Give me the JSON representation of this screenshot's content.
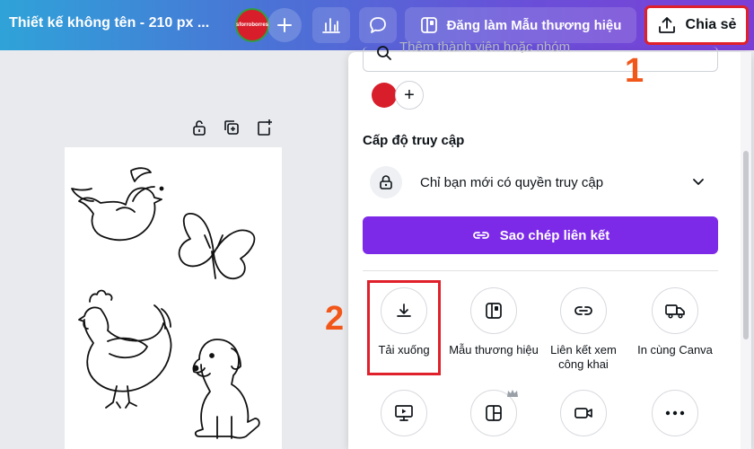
{
  "topbar": {
    "title": "Thiết kế không tên - 210 px ...",
    "avatar_text": "sforroborres",
    "brand_button": "Đăng làm Mẫu thương hiệu",
    "share_button": "Chia sẻ"
  },
  "panel": {
    "search_placeholder": "Thêm thành viên hoặc nhóm",
    "add_plus": "+",
    "access_label": "Cấp độ truy cập",
    "access_value": "Chỉ bạn mới có quyền truy cập",
    "copy_link": "Sao chép liên kết",
    "options_row1": [
      {
        "label": "Tải xuống",
        "icon": "download-icon"
      },
      {
        "label": "Mẫu thương hiệu",
        "icon": "brand-template-icon"
      },
      {
        "label": "Liên kết xem công khai",
        "icon": "link-icon"
      },
      {
        "label": "In cùng Canva",
        "icon": "truck-icon"
      }
    ],
    "options_row2": [
      {
        "icon": "present-icon"
      },
      {
        "icon": "template-icon"
      },
      {
        "icon": "video-icon"
      },
      {
        "icon": "more-icon"
      }
    ]
  },
  "annotations": {
    "step1": "1",
    "step2": "2"
  },
  "colors": {
    "accent": "#7d2ae8",
    "highlight": "#e0202a",
    "step": "#f2571a"
  }
}
